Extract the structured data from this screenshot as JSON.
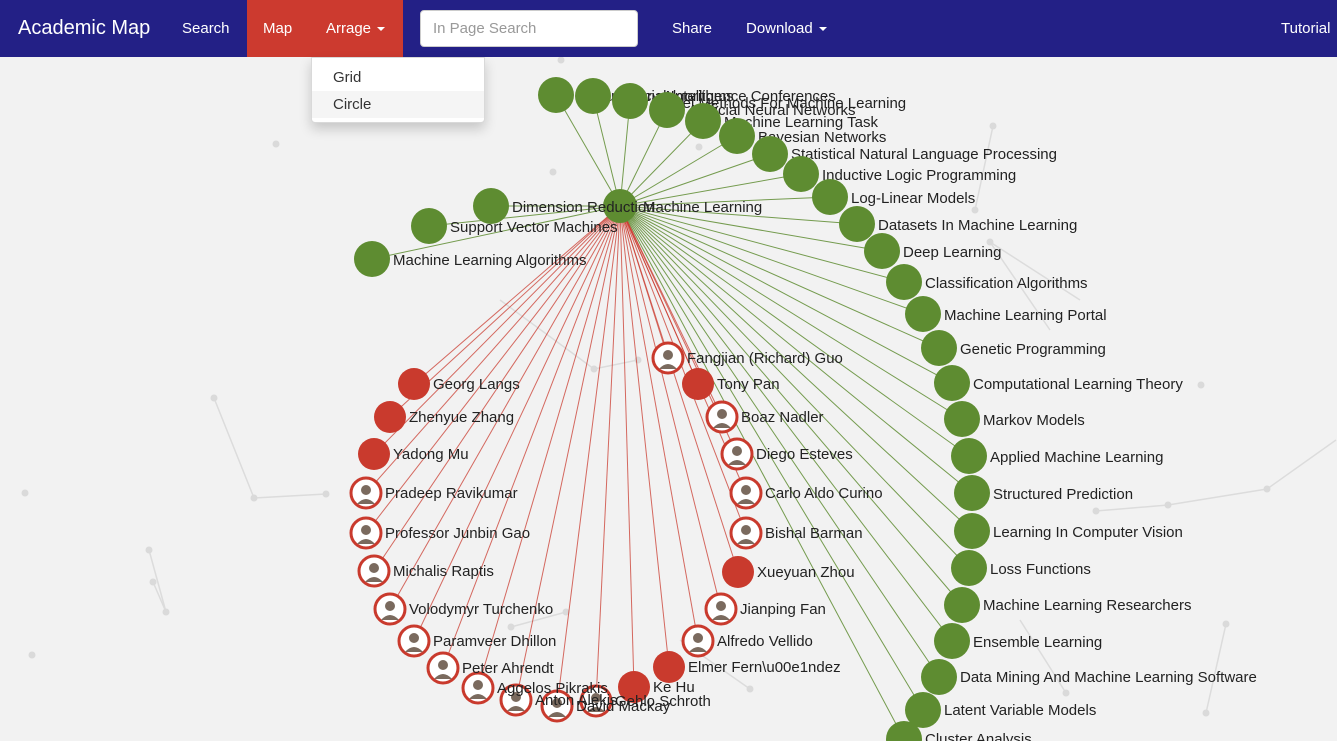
{
  "navbar": {
    "brand": "Academic Map",
    "search_link": "Search",
    "map_link": "Map",
    "arrange_link": "Arrage",
    "in_page_search_placeholder": "In Page Search",
    "share_link": "Share",
    "download_link": "Download",
    "tutorial_link": "Tutorial"
  },
  "arrange_menu": {
    "items": [
      "Grid",
      "Circle"
    ],
    "highlighted": "Circle"
  },
  "colors": {
    "navbar": "#232086",
    "active": "#cc3a2f",
    "topic_node": "#5e8c31",
    "person_node": "#c93a2d",
    "background": "#f2f2f2"
  },
  "graph": {
    "hub": "Machine Learning",
    "topics": [
      "Evolutionary Algorithms",
      "Artificial Intelligence Conferences",
      "Kernel Methods For Machine Learning",
      "Artificial Neural Networks",
      "Machine Learning Task",
      "Bayesian Networks",
      "Statistical Natural Language Processing",
      "Inductive Logic Programming",
      "Log-Linear Models",
      "Datasets In Machine Learning",
      "Deep Learning",
      "Classification Algorithms",
      "Machine Learning Portal",
      "Genetic Programming",
      "Computational Learning Theory",
      "Markov Models",
      "Applied Machine Learning",
      "Structured Prediction",
      "Learning In Computer Vision",
      "Loss Functions",
      "Machine Learning Researchers",
      "Ensemble Learning",
      "Data Mining And Machine Learning Software",
      "Latent Variable Models",
      "Cluster Analysis",
      "Dimension Reduction",
      "Support Vector Machines",
      "Machine Learning Algorithms"
    ],
    "people": [
      "Fangjian (Richard) Guo",
      "Tony Pan",
      "Boaz Nadler",
      "Diego Esteves",
      "Carlo Aldo Curino",
      "Bishal Barman",
      "Xueyuan Zhou",
      "Jianping Fan",
      "Alfredo Vellido",
      "Elmer Fern\\u00e1ndez",
      "Ke Hu",
      "Gehlo Schroth",
      "David Mackay",
      "Anton Alekis",
      "Aggelos Pikrakis",
      "Peter Ahrendt",
      "Paramveer Dhillon",
      "Volodymyr Turchenko",
      "Michalis Raptis",
      "Professor Junbin Gao",
      "Pradeep Ravikumar",
      "Yadong Mu",
      "Zhenyue Zhang",
      "Georg Langs"
    ]
  }
}
